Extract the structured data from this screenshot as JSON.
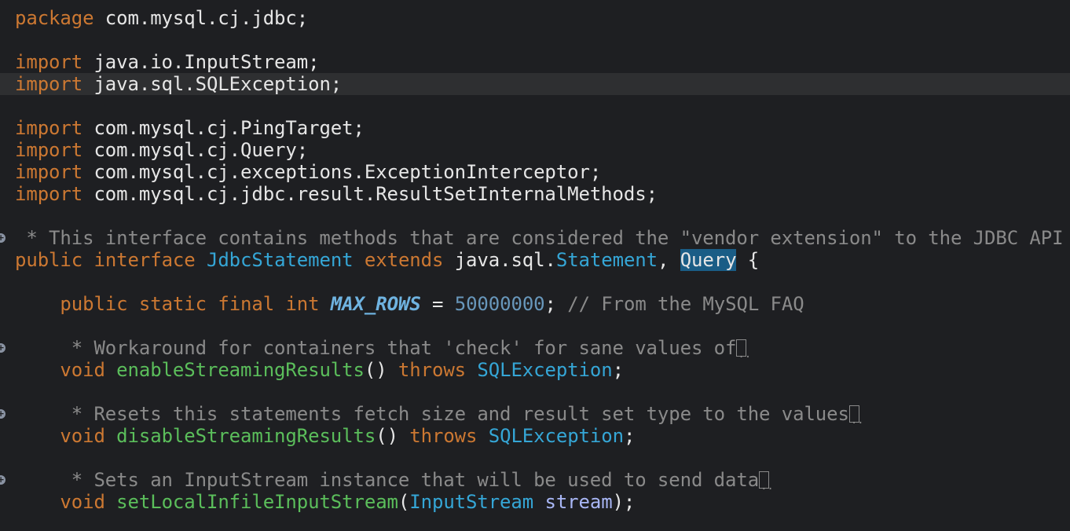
{
  "editor": {
    "language": "Java",
    "colors": {
      "background": "#1e1f22",
      "current_line": "#2e2f31",
      "keyword": "#cc7832",
      "comment": "#8a8a8a",
      "type": "#35a6d6",
      "method": "#5bbe5b",
      "number": "#6897bb",
      "match_highlight": "#1a5d86"
    },
    "lines": [
      {
        "line_index": 0,
        "segments": [
          {
            "t": "package",
            "c": "kw"
          },
          {
            "t": " com.mysql.cj.jdbc;",
            "c": ""
          }
        ]
      },
      {
        "line_index": 1,
        "segments": []
      },
      {
        "line_index": 2,
        "segments": [
          {
            "t": "import",
            "c": "kw"
          },
          {
            "t": " java.io.InputStream;",
            "c": ""
          }
        ]
      },
      {
        "line_index": 3,
        "current": true,
        "segments": [
          {
            "t": "import",
            "c": "kw"
          },
          {
            "t": " java.sql.SQLException;",
            "c": ""
          }
        ]
      },
      {
        "line_index": 4,
        "segments": []
      },
      {
        "line_index": 5,
        "segments": [
          {
            "t": "import",
            "c": "kw"
          },
          {
            "t": " com.mysql.cj.PingTarget;",
            "c": ""
          }
        ]
      },
      {
        "line_index": 6,
        "segments": [
          {
            "t": "import",
            "c": "kw"
          },
          {
            "t": " com.mysql.cj.Query;",
            "c": ""
          }
        ]
      },
      {
        "line_index": 7,
        "segments": [
          {
            "t": "import",
            "c": "kw"
          },
          {
            "t": " com.mysql.cj.exceptions.ExceptionInterceptor;",
            "c": ""
          }
        ]
      },
      {
        "line_index": 8,
        "segments": [
          {
            "t": "import",
            "c": "kw"
          },
          {
            "t": " com.mysql.cj.jdbc.result.ResultSetInternalMethods;",
            "c": ""
          }
        ]
      },
      {
        "line_index": 9,
        "segments": []
      },
      {
        "line_index": 10,
        "fold": true,
        "segments": [
          {
            "t": " * This interface contains methods that are considered the \"vendor extension\" to the JDBC API",
            "c": "doc"
          }
        ]
      },
      {
        "line_index": 11,
        "segments": [
          {
            "t": "public",
            "c": "kw"
          },
          {
            "t": " ",
            "c": ""
          },
          {
            "t": "interface",
            "c": "kw"
          },
          {
            "t": " ",
            "c": ""
          },
          {
            "t": "JdbcStatement",
            "c": "type"
          },
          {
            "t": " ",
            "c": ""
          },
          {
            "t": "extends",
            "c": "kw"
          },
          {
            "t": " java.sql.",
            "c": ""
          },
          {
            "t": "Statement",
            "c": "type"
          },
          {
            "t": ", ",
            "c": ""
          },
          {
            "t": "Query",
            "c": "type match"
          },
          {
            "t": " {",
            "c": ""
          }
        ]
      },
      {
        "line_index": 12,
        "segments": []
      },
      {
        "line_index": 13,
        "segments": [
          {
            "t": "    ",
            "c": ""
          },
          {
            "t": "public",
            "c": "kw"
          },
          {
            "t": " ",
            "c": ""
          },
          {
            "t": "static",
            "c": "kw"
          },
          {
            "t": " ",
            "c": ""
          },
          {
            "t": "final",
            "c": "kw"
          },
          {
            "t": " ",
            "c": ""
          },
          {
            "t": "int",
            "c": "kw"
          },
          {
            "t": " ",
            "c": ""
          },
          {
            "t": "MAX_ROWS",
            "c": "const"
          },
          {
            "t": " = ",
            "c": ""
          },
          {
            "t": "50000000",
            "c": "num"
          },
          {
            "t": "; ",
            "c": ""
          },
          {
            "t": "// From the MySQL FAQ",
            "c": "cm"
          }
        ]
      },
      {
        "line_index": 14,
        "segments": []
      },
      {
        "line_index": 15,
        "fold": true,
        "collapsed": true,
        "segments": [
          {
            "t": "     * Workaround for containers that 'check' for sane values of",
            "c": "doc"
          }
        ]
      },
      {
        "line_index": 16,
        "segments": [
          {
            "t": "    ",
            "c": ""
          },
          {
            "t": "void",
            "c": "kw"
          },
          {
            "t": " ",
            "c": ""
          },
          {
            "t": "enableStreamingResults",
            "c": "method"
          },
          {
            "t": "() ",
            "c": ""
          },
          {
            "t": "throws",
            "c": "kw"
          },
          {
            "t": " ",
            "c": ""
          },
          {
            "t": "SQLException",
            "c": "type"
          },
          {
            "t": ";",
            "c": ""
          }
        ]
      },
      {
        "line_index": 17,
        "segments": []
      },
      {
        "line_index": 18,
        "fold": true,
        "collapsed": true,
        "segments": [
          {
            "t": "     * Resets this statements fetch size and result set type to the values",
            "c": "doc"
          }
        ]
      },
      {
        "line_index": 19,
        "segments": [
          {
            "t": "    ",
            "c": ""
          },
          {
            "t": "void",
            "c": "kw"
          },
          {
            "t": " ",
            "c": ""
          },
          {
            "t": "disableStreamingResults",
            "c": "method"
          },
          {
            "t": "() ",
            "c": ""
          },
          {
            "t": "throws",
            "c": "kw"
          },
          {
            "t": " ",
            "c": ""
          },
          {
            "t": "SQLException",
            "c": "type"
          },
          {
            "t": ";",
            "c": ""
          }
        ]
      },
      {
        "line_index": 20,
        "segments": []
      },
      {
        "line_index": 21,
        "fold": true,
        "collapsed": true,
        "segments": [
          {
            "t": "     * Sets an InputStream instance that will be used to send data",
            "c": "doc"
          }
        ]
      },
      {
        "line_index": 22,
        "segments": [
          {
            "t": "    ",
            "c": ""
          },
          {
            "t": "void",
            "c": "kw"
          },
          {
            "t": " ",
            "c": ""
          },
          {
            "t": "setLocalInfileInputStream",
            "c": "method"
          },
          {
            "t": "(",
            "c": ""
          },
          {
            "t": "InputStream",
            "c": "type"
          },
          {
            "t": " ",
            "c": ""
          },
          {
            "t": "stream",
            "c": "param"
          },
          {
            "t": ");",
            "c": ""
          }
        ]
      }
    ]
  }
}
